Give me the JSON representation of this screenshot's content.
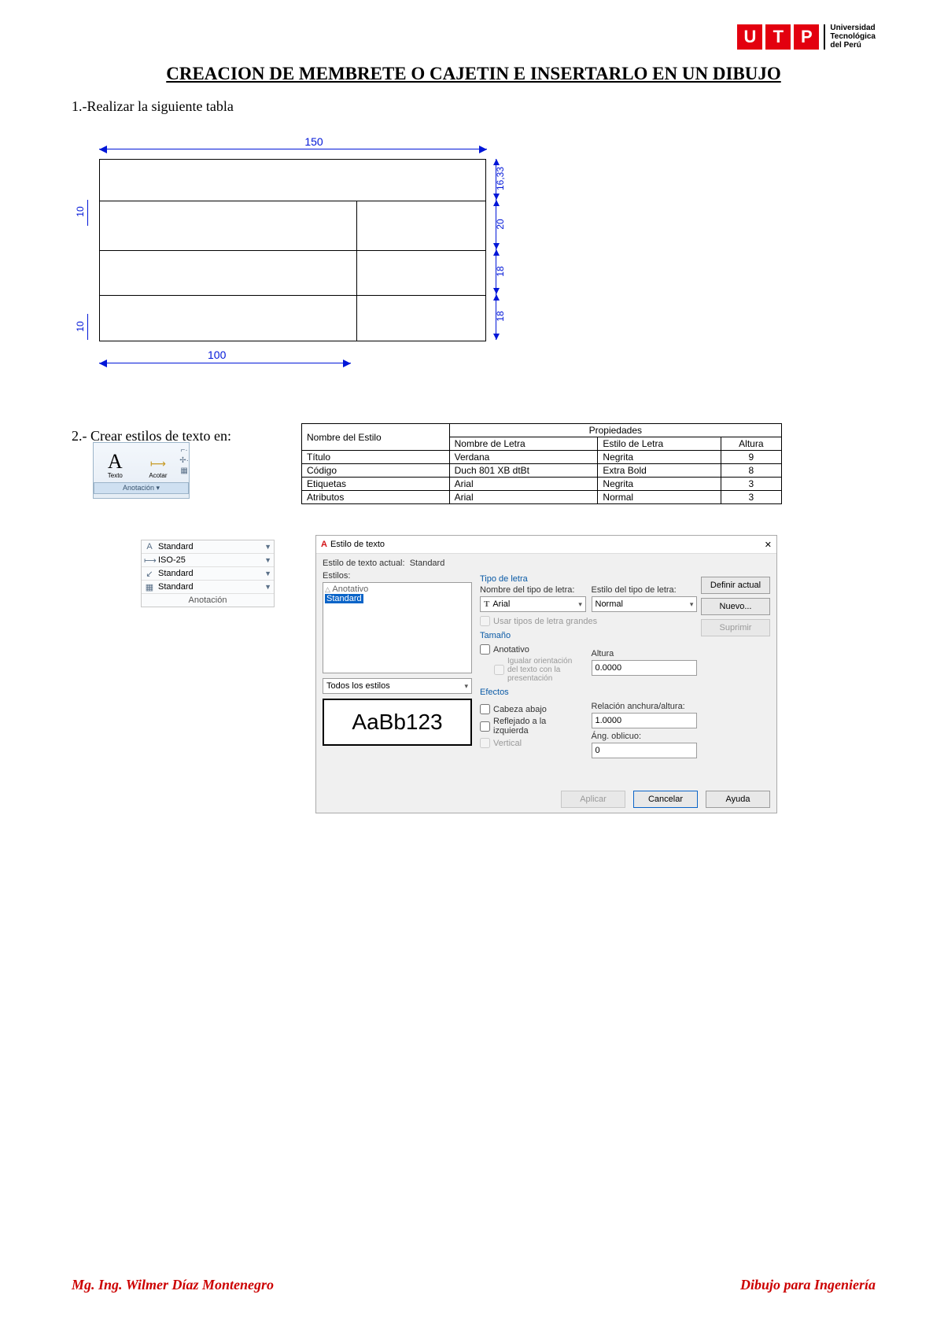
{
  "logo": {
    "letters": [
      "U",
      "T",
      "P"
    ],
    "subtitle_l1": "Universidad",
    "subtitle_l2": "Tecnológica",
    "subtitle_l3": "del Perú"
  },
  "title": "CREACION DE MEMBRETE O CAJETIN E INSERTARLO EN UN DIBUJO",
  "step1": "1.-Realizar la siguiente tabla",
  "dims": {
    "top": "150",
    "r1": "16,33",
    "r2": "20",
    "r3": "18",
    "r4": "18",
    "left_top": "10",
    "left_bot": "10",
    "bottom": "100"
  },
  "step2": "2.- Crear estilos de texto en:",
  "prop_table": {
    "h1": "Nombre del Estilo",
    "h2": "Propiedades",
    "c_name": "Nombre de Letra",
    "c_style": "Estilo de Letra",
    "c_height": "Altura",
    "rows": [
      {
        "n": "Título",
        "font": "Verdana",
        "style": "Negrita",
        "h": "9"
      },
      {
        "n": "Código",
        "font": "Duch 801 XB dtBt",
        "style": "Extra Bold",
        "h": "8"
      },
      {
        "n": "Etiquetas",
        "font": "Arial",
        "style": "Negrita",
        "h": "3"
      },
      {
        "n": "Atributos",
        "font": "Arial",
        "style": "Normal",
        "h": "3"
      }
    ]
  },
  "anno_panel": {
    "texto": "Texto",
    "acotar": "Acotar",
    "tab": "Anotación"
  },
  "style_list": {
    "r1": "Standard",
    "r2": "ISO-25",
    "r3": "Standard",
    "r4": "Standard",
    "r5": "Anotación"
  },
  "dialog": {
    "title": "Estilo de texto",
    "current_lbl": "Estilo de texto actual:",
    "current_val": "Standard",
    "styles_lbl": "Estilos:",
    "list_annot": "Anotativo",
    "list_sel": "Standard",
    "filter": "Todos los estilos",
    "preview": "AaBb123",
    "grp_tipo": "Tipo de letra",
    "lbl_fontname": "Nombre del tipo de letra:",
    "val_fontname": "Arial",
    "lbl_fontstyle": "Estilo del tipo de letra:",
    "val_fontstyle": "Normal",
    "chk_bigfont": "Usar tipos de letra grandes",
    "grp_tam": "Tamaño",
    "chk_annot": "Anotativo",
    "chk_match": "Igualar orientación del texto con la presentación",
    "lbl_height": "Altura",
    "val_height": "0.0000",
    "grp_efectos": "Efectos",
    "chk_upside": "Cabeza abajo",
    "chk_mirror": "Reflejado a la izquierda",
    "chk_vert": "Vertical",
    "lbl_ratio": "Relación anchura/altura:",
    "val_ratio": "1.0000",
    "lbl_oblique": "Áng. oblicuo:",
    "val_oblique": "0",
    "btn_setcur": "Definir actual",
    "btn_new": "Nuevo...",
    "btn_del": "Suprimir",
    "btn_apply": "Aplicar",
    "btn_cancel": "Cancelar",
    "btn_help": "Ayuda"
  },
  "footer": {
    "left": "Mg. Ing. Wilmer Díaz Montenegro",
    "right": "Dibujo para Ingeniería"
  }
}
